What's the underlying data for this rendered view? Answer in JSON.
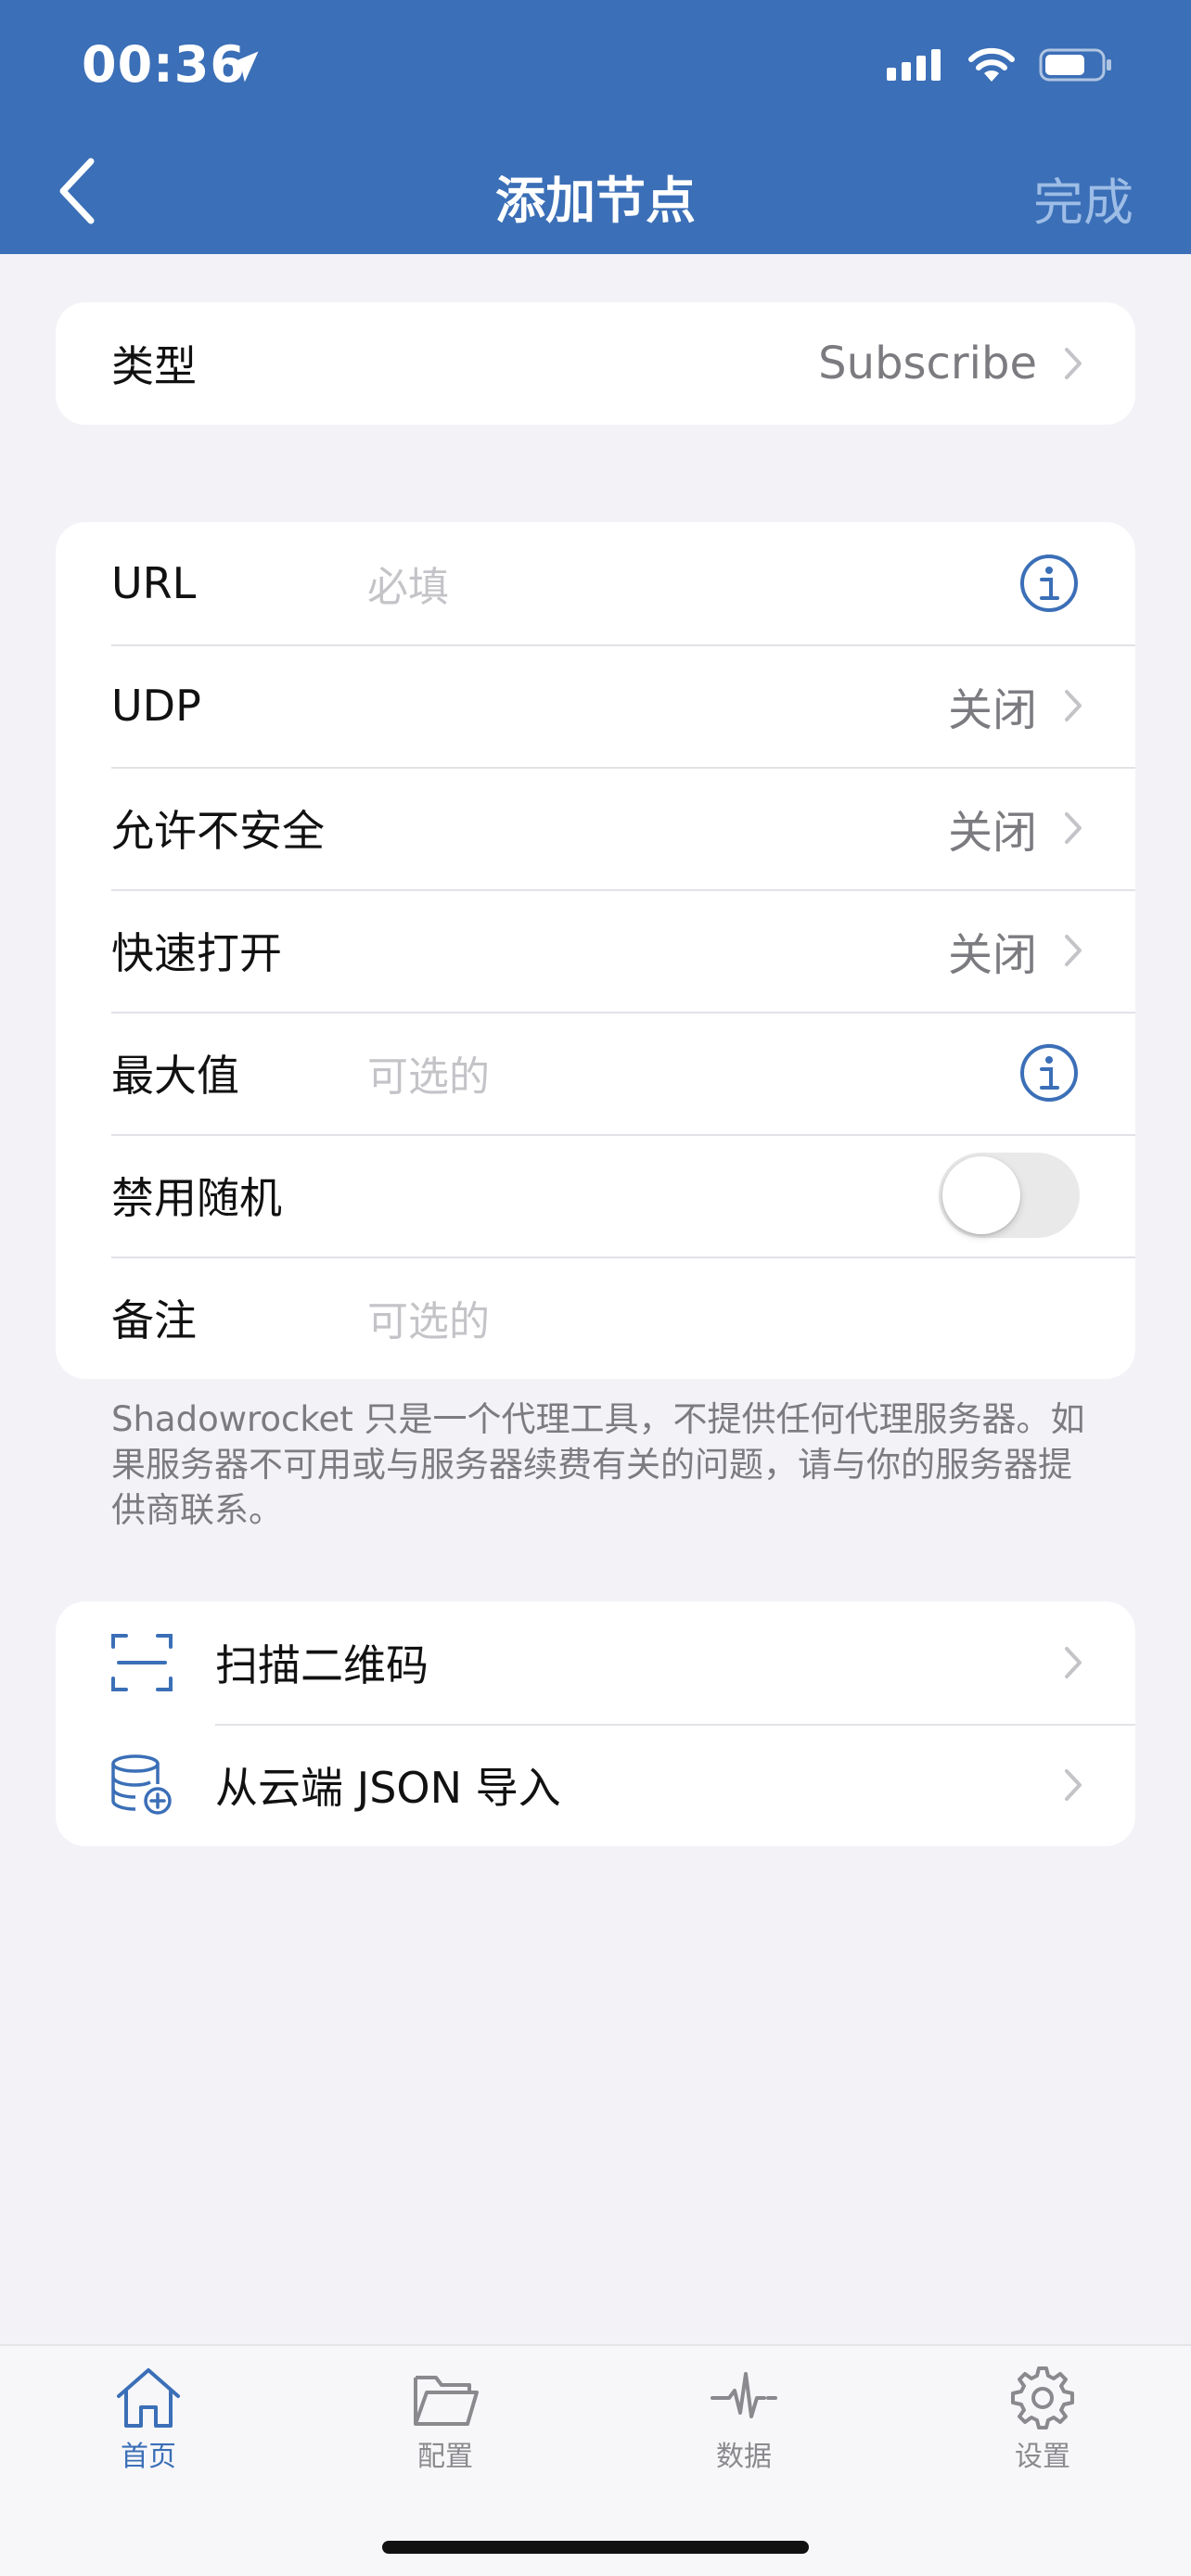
{
  "status_bar": {
    "time": "00:36"
  },
  "nav": {
    "title": "添加节点",
    "done_label": "完成"
  },
  "type_card": {
    "label": "类型",
    "value": "Subscribe"
  },
  "form": {
    "url": {
      "label": "URL",
      "placeholder": "必填"
    },
    "udp": {
      "label": "UDP",
      "value": "关闭"
    },
    "allow_insecure": {
      "label": "允许不安全",
      "value": "关闭"
    },
    "fast_open": {
      "label": "快速打开",
      "value": "关闭"
    },
    "max_value": {
      "label": "最大值",
      "placeholder": "可选的"
    },
    "disable_random": {
      "label": "禁用随机",
      "enabled": false
    },
    "remark": {
      "label": "备注",
      "placeholder": "可选的"
    }
  },
  "note": "Shadowrocket 只是一个代理工具，不提供任何代理服务器。如果服务器不可用或与服务器续费有关的问题，请与你的服务器提供商联系。",
  "actions": [
    {
      "label": "扫描二维码",
      "icon": "scan-qr-icon"
    },
    {
      "label": "从云端 JSON 导入",
      "icon": "database-import-icon"
    }
  ],
  "tabbar": [
    {
      "label": "首页",
      "icon": "home-icon",
      "active": true
    },
    {
      "label": "配置",
      "icon": "folder-icon",
      "active": false
    },
    {
      "label": "数据",
      "icon": "activity-icon",
      "active": false
    },
    {
      "label": "设置",
      "icon": "gear-icon",
      "active": false
    }
  ],
  "colors": {
    "header": "#3b6fb7",
    "accent": "#3b6fb7",
    "background": "#f2f2f7"
  }
}
